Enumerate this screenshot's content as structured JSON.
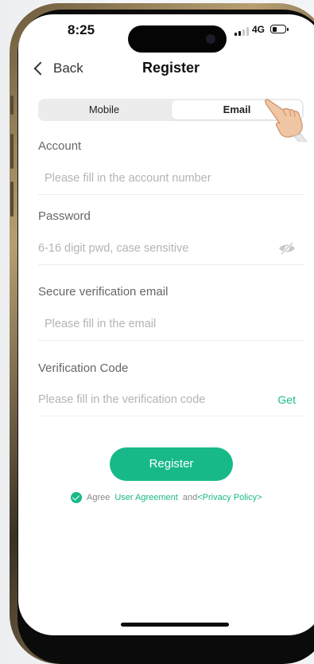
{
  "status_bar": {
    "time": "8:25",
    "network": "4G"
  },
  "nav": {
    "back_label": "Back",
    "title": "Register"
  },
  "tabs": [
    {
      "label": "Mobile",
      "selected": false
    },
    {
      "label": "Email",
      "selected": true
    }
  ],
  "form": {
    "account": {
      "label": "Account",
      "placeholder": "Please fill in the account number",
      "value": ""
    },
    "password": {
      "label": "Password",
      "placeholder": "6-16 digit pwd, case sensitive",
      "value": ""
    },
    "email": {
      "label": "Secure verification email",
      "placeholder": "Please fill in the email",
      "value": ""
    },
    "code": {
      "label": "Verification Code",
      "placeholder": "Please fill in the verification code",
      "value": "",
      "get_label": "Get"
    }
  },
  "register_button": "Register",
  "agreement": {
    "prefix": "Agree",
    "user_agreement": "User Agreement",
    "and": "and",
    "privacy_policy": "<Privacy Policy>",
    "checked": true
  },
  "colors": {
    "accent": "#17b988"
  },
  "icons": [
    "chevron-left-icon",
    "eye-off-icon",
    "check-circle-icon",
    "pointing-hand-icon",
    "signal-icon",
    "battery-icon"
  ]
}
